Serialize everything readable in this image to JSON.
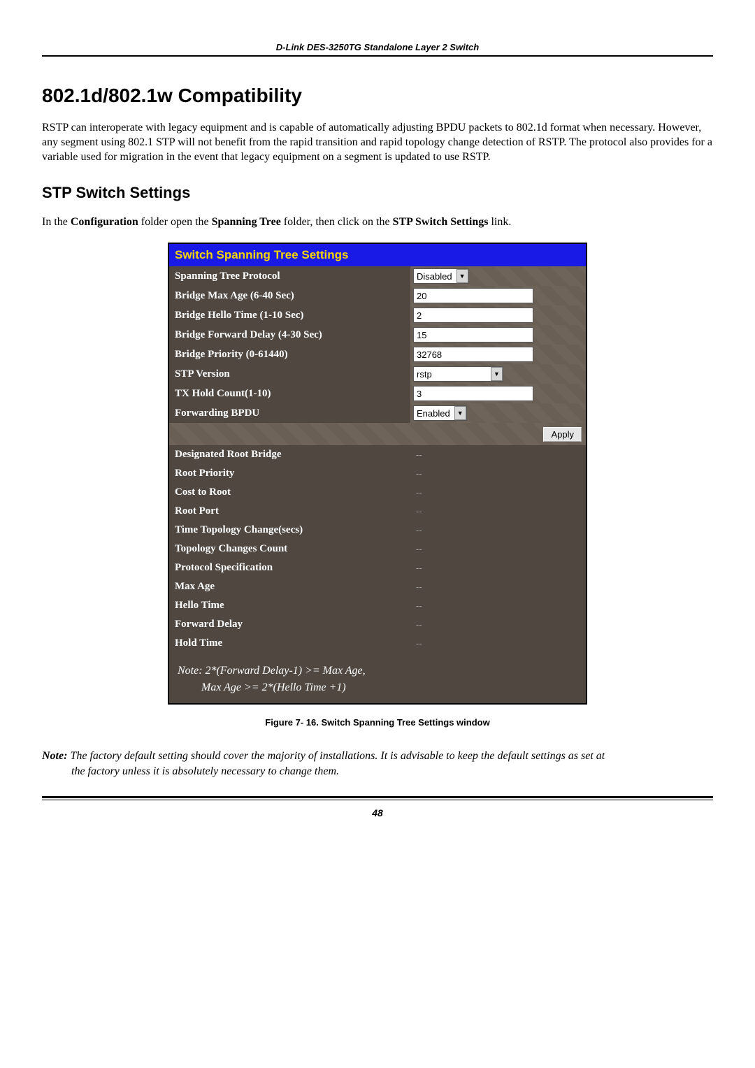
{
  "header": {
    "product_line": "D-Link DES-3250TG Standalone Layer 2 Switch"
  },
  "section": {
    "heading": "802.1d/802.1w Compatibility",
    "paragraph": "RSTP can interoperate with legacy equipment and is capable of automatically adjusting BPDU packets to 802.1d format when necessary. However, any segment using 802.1 STP will not benefit from the rapid transition and rapid topology change detection of RSTP. The protocol also provides for a variable used for migration in the event that legacy equipment on a segment is updated to use RSTP."
  },
  "subsection": {
    "heading": "STP Switch Settings",
    "intro_prefix": "In the ",
    "intro_b1": "Configuration",
    "intro_mid1": " folder open the ",
    "intro_b2": "Spanning Tree",
    "intro_mid2": " folder, then click on the ",
    "intro_b3": "STP Switch Settings",
    "intro_suffix": " link."
  },
  "panel": {
    "title": "Switch Spanning Tree Settings",
    "editable": [
      {
        "label": "Spanning Tree Protocol",
        "control": "dropdown",
        "value": "Disabled"
      },
      {
        "label": "Bridge Max Age (6-40 Sec)",
        "control": "input",
        "value": "20"
      },
      {
        "label": "Bridge Hello Time (1-10 Sec)",
        "control": "input",
        "value": "2"
      },
      {
        "label": "Bridge Forward Delay (4-30 Sec)",
        "control": "input",
        "value": "15"
      },
      {
        "label": "Bridge Priority (0-61440)",
        "control": "input",
        "value": "32768"
      },
      {
        "label": "STP Version",
        "control": "dropdown_wide",
        "value": "rstp"
      },
      {
        "label": "TX Hold Count(1-10)",
        "control": "input",
        "value": "3"
      },
      {
        "label": "Forwarding BPDU",
        "control": "dropdown",
        "value": "Enabled"
      }
    ],
    "apply_label": "Apply",
    "readonly": [
      {
        "label": "Designated Root Bridge",
        "value": "--"
      },
      {
        "label": "Root Priority",
        "value": "--"
      },
      {
        "label": "Cost to Root",
        "value": "--"
      },
      {
        "label": "Root Port",
        "value": "--"
      },
      {
        "label": "Time Topology Change(secs)",
        "value": "--"
      },
      {
        "label": "Topology Changes Count",
        "value": "--"
      },
      {
        "label": "Protocol Specification",
        "value": "--"
      },
      {
        "label": "Max Age",
        "value": "--"
      },
      {
        "label": "Hello Time",
        "value": "--"
      },
      {
        "label": "Forward Delay",
        "value": "--"
      },
      {
        "label": "Hold Time",
        "value": "--"
      }
    ],
    "note_line1": "Note: 2*(Forward Delay-1) >= Max Age,",
    "note_line2": "Max Age >= 2*(Hello Time +1)"
  },
  "figure_caption": "Figure 7- 16.  Switch Spanning Tree Settings window",
  "footnote": {
    "label": "Note: ",
    "body_part1": "The factory default setting should cover the majority of installations. It is advisable to keep the default settings as set at",
    "body_part2": "the factory unless it is absolutely necessary to change them."
  },
  "page_number": "48"
}
